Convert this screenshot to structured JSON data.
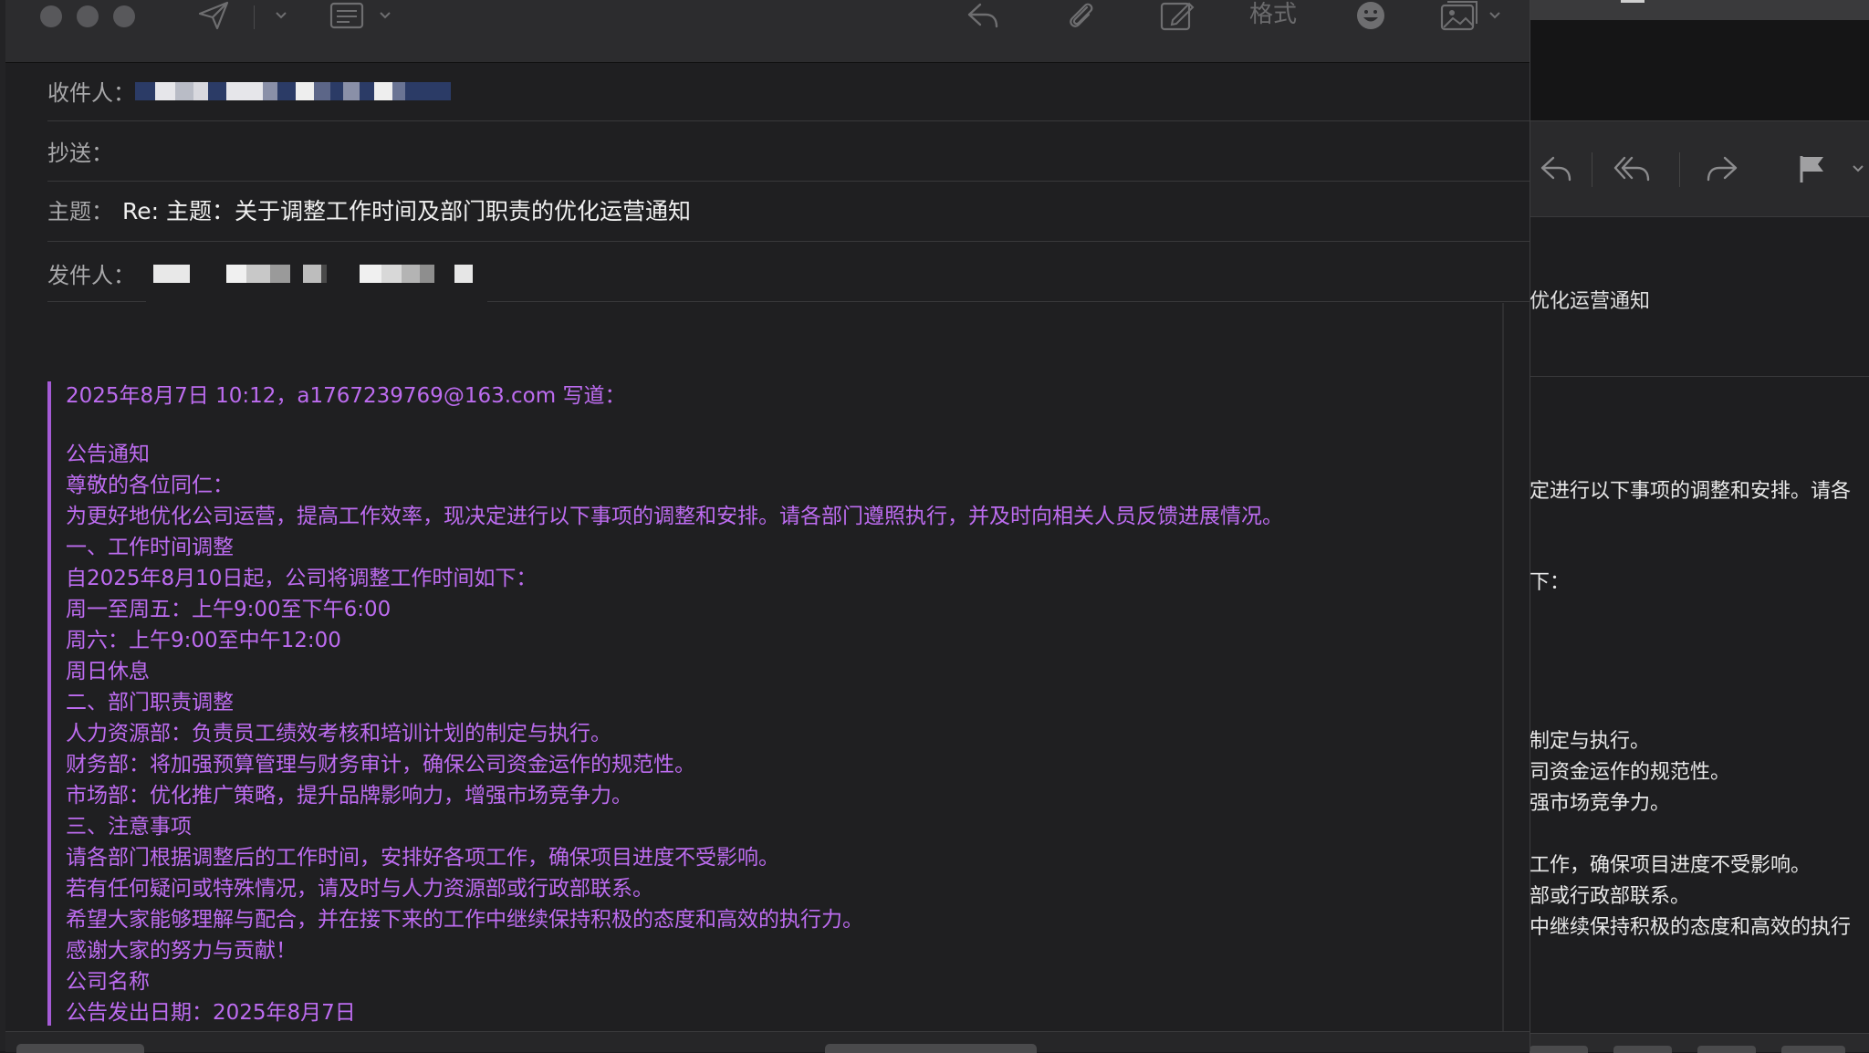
{
  "compose": {
    "toolbar": {
      "format_label": "格式"
    },
    "fields": {
      "to_label": "收件人：",
      "cc_label": "抄送：",
      "subject_label": "主题：",
      "subject_value": "Re: 主题：关于调整工作时间及部门职责的优化运营通知",
      "from_label": "发件人："
    },
    "quoted": {
      "header": "2025年8月7日 10:12，a1767239769@163.com 写道：",
      "lines": [
        "公告通知",
        "尊敬的各位同仁：",
        "为更好地优化公司运营，提高工作效率，现决定进行以下事项的调整和安排。请各部门遵照执行，并及时向相关人员反馈进展情况。",
        "一、工作时间调整",
        "自2025年8月10日起，公司将调整工作时间如下：",
        "周一至周五：上午9:00至下午6:00",
        "周六：上午9:00至中午12:00",
        "周日休息",
        "二、部门职责调整",
        "人力资源部：负责员工绩效考核和培训计划的制定与执行。",
        "财务部：将加强预算管理与财务审计，确保公司资金运作的规范性。",
        "市场部：优化推广策略，提升品牌影响力，增强市场竞争力。",
        "三、注意事项",
        "请各部门根据调整后的工作时间，安排好各项工作，确保项目进度不受影响。",
        "若有任何疑问或特殊情况，请及时与人力资源部或行政部联系。",
        "希望大家能够理解与配合，并在接下来的工作中继续保持积极的态度和高效的执行力。",
        "感谢大家的努力与贡献！",
        "公司名称",
        "公告发出日期：2025年8月7日"
      ]
    }
  },
  "viewer": {
    "subject_fragment": "优化运营通知",
    "fragments": [
      "定进行以下事项的调整和安排。请各",
      "下：",
      "制定与执行。",
      "司资金运作的规范性。",
      "强市场竞争力。",
      "工作，确保项目进度不受影响。",
      "部或行政部联系。",
      "中继续保持积极的态度和高效的执行"
    ]
  },
  "colors": {
    "quote_text": "#bd6cf0",
    "quote_bar": "#a55bd6",
    "window_bg": "#1f1f21",
    "toolbar_bg": "#2c2c2e"
  }
}
